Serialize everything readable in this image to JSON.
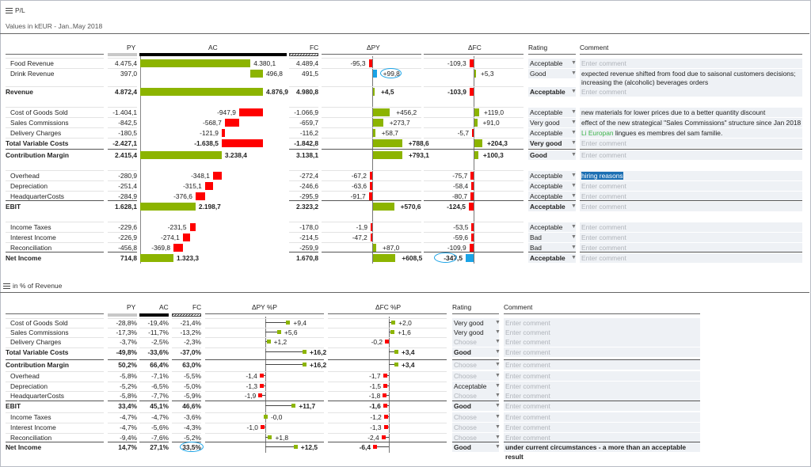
{
  "section1": {
    "title": "P/L",
    "subtitle": "Values in kEUR - Jan..May 2018",
    "headers": {
      "py": "PY",
      "ac": "AC",
      "fc": "FC",
      "dpy": "ΔPY",
      "dfc": "ΔFC",
      "rating": "Rating",
      "comment": "Comment"
    },
    "rows": [
      {
        "label": "Food Revenue",
        "indent": true,
        "bold": false,
        "py": "4.475,4",
        "ac": "4.380,1",
        "fc": "4.489,4",
        "dpy": "-95,3",
        "dfc": "-109,3",
        "ac_v": 4380.1,
        "dpy_v": -95.3,
        "dfc_v": -109.3,
        "rating": "Acceptable",
        "comment": "",
        "ac_type": "result"
      },
      {
        "label": "Drink Revenue",
        "indent": true,
        "bold": false,
        "py": "397,0",
        "ac": "496,8",
        "fc": "491,5",
        "dpy": "+99,8",
        "dfc": "+5,3",
        "ac_v": 496.8,
        "dpy_v": 99.8,
        "dfc_v": 5.3,
        "rating": "Good",
        "comment": "expected revenue shifted from food due to saisonal customers decisions; increasing the (alcoholic) beverages orders",
        "ac_type": "step",
        "dpy_highlight": true,
        "tall": true
      },
      {
        "label": "Revenue",
        "indent": false,
        "bold": true,
        "py": "4.872,4",
        "ac": "4.876,9",
        "fc": "4.980,8",
        "dpy": "+4,5",
        "dfc": "-103,9",
        "ac_v": 4876.9,
        "dpy_v": 4.5,
        "dfc_v": -103.9,
        "rating": "Acceptable",
        "comment": "",
        "ac_type": "result",
        "gap_after": true
      },
      {
        "label": "Cost of Goods Sold",
        "indent": true,
        "bold": false,
        "py": "-1.404,1",
        "ac": "-947,9",
        "fc": "-1.066,9",
        "dpy": "+456,2",
        "dfc": "+119,0",
        "ac_v": -947.9,
        "dpy_v": 456.2,
        "dfc_v": 119.0,
        "rating": "Acceptable",
        "comment": "new materials for lower prices due to a better quantity discount",
        "ac_type": "step"
      },
      {
        "label": "Sales Commissions",
        "indent": true,
        "bold": false,
        "py": "-842,5",
        "ac": "-568,7",
        "fc": "-659,7",
        "dpy": "+273,7",
        "dfc": "+91,0",
        "ac_v": -568.7,
        "dpy_v": 273.7,
        "dfc_v": 91.0,
        "rating": "Very good",
        "comment": "effect of the new strategical \"Sales Commissions\" structure since Jan 2018",
        "ac_type": "step"
      },
      {
        "label": "Delivery Charges",
        "indent": true,
        "bold": false,
        "py": "-180,5",
        "ac": "-121,9",
        "fc": "-116,2",
        "dpy": "+58,7",
        "dfc": "-5,7",
        "ac_v": -121.9,
        "dpy_v": 58.7,
        "dfc_v": -5.7,
        "rating": "Acceptable",
        "comment_green": "Li Europan",
        "comment": " lingues es membres del sam familie.",
        "ac_type": "step"
      },
      {
        "label": "Total Variable Costs",
        "indent": false,
        "bold": true,
        "py": "-2.427,1",
        "ac": "-1.638,5",
        "fc": "-1.842,8",
        "dpy": "+788,6",
        "dfc": "+204,3",
        "ac_v": -1638.5,
        "dpy_v": 788.6,
        "dfc_v": 204.3,
        "rating": "Very good",
        "comment": "",
        "ac_type": "sum"
      },
      {
        "label": "Contribution Margin",
        "indent": false,
        "bold": true,
        "py": "2.415,4",
        "ac": "3.238,4",
        "fc": "3.138,1",
        "dpy": "+793,1",
        "dfc": "+100,3",
        "ac_v": 3238.4,
        "dpy_v": 793.1,
        "dfc_v": 100.3,
        "rating": "Good",
        "comment": "",
        "ac_type": "result",
        "line_before": true,
        "gap_after": true
      },
      {
        "label": "Overhead",
        "indent": true,
        "bold": false,
        "py": "-280,9",
        "ac": "-348,1",
        "fc": "-272,4",
        "dpy": "-67,2",
        "dfc": "-75,7",
        "ac_v": -348.1,
        "dpy_v": -67.2,
        "dfc_v": -75.7,
        "rating": "Acceptable",
        "comment": "hiring reasons",
        "comment_selected": true,
        "ac_type": "step"
      },
      {
        "label": "Depreciation",
        "indent": true,
        "bold": false,
        "py": "-251,4",
        "ac": "-315,1",
        "fc": "-246,6",
        "dpy": "-63,6",
        "dfc": "-58,4",
        "ac_v": -315.1,
        "dpy_v": -63.6,
        "dfc_v": -58.4,
        "rating": "Acceptable",
        "comment": "",
        "ac_type": "step"
      },
      {
        "label": "HeadquarterCosts",
        "indent": true,
        "bold": false,
        "py": "-284,9",
        "ac": "-376,6",
        "fc": "-295,9",
        "dpy": "-91,7",
        "dfc": "-80,7",
        "ac_v": -376.6,
        "dpy_v": -91.7,
        "dfc_v": -80.7,
        "rating": "Acceptable",
        "comment": "",
        "ac_type": "step"
      },
      {
        "label": "EBIT",
        "indent": false,
        "bold": true,
        "py": "1.628,1",
        "ac": "2.198,7",
        "fc": "2.323,2",
        "dpy": "+570,6",
        "dfc": "-124,5",
        "ac_v": 2198.7,
        "dpy_v": 570.6,
        "dfc_v": -124.5,
        "rating": "Acceptable",
        "comment": "",
        "ac_type": "result",
        "line_before": true,
        "gap_after": true
      },
      {
        "label": "Income Taxes",
        "indent": true,
        "bold": false,
        "py": "-229,6",
        "ac": "-231,5",
        "fc": "-178,0",
        "dpy": "-1,9",
        "dfc": "-53,5",
        "ac_v": -231.5,
        "dpy_v": -1.9,
        "dfc_v": -53.5,
        "rating": "Acceptable",
        "comment": "",
        "ac_type": "step"
      },
      {
        "label": "Interest Income",
        "indent": true,
        "bold": false,
        "py": "-226,9",
        "ac": "-274,1",
        "fc": "-214,5",
        "dpy": "-47,2",
        "dfc": "-59,6",
        "ac_v": -274.1,
        "dpy_v": -47.2,
        "dfc_v": -59.6,
        "rating": "Bad",
        "comment": "",
        "ac_type": "step"
      },
      {
        "label": "Reconciliation",
        "indent": true,
        "bold": false,
        "py": "-456,8",
        "ac": "-369,8",
        "fc": "-259,9",
        "dpy": "+87,0",
        "dfc": "-109,9",
        "ac_v": -369.8,
        "dpy_v": 87.0,
        "dfc_v": -109.9,
        "rating": "Bad",
        "comment": "",
        "ac_type": "step"
      },
      {
        "label": "Net Income",
        "indent": false,
        "bold": true,
        "py": "714,8",
        "ac": "1.323,3",
        "fc": "1.670,8",
        "dpy": "+608,5",
        "dfc": "-347,5",
        "ac_v": 1323.3,
        "dpy_v": 608.5,
        "dfc_v": -347.5,
        "rating": "Acceptable",
        "comment": "",
        "ac_type": "result",
        "line_before": true,
        "dfc_highlight": true
      }
    ]
  },
  "section2": {
    "title": "in % of Revenue",
    "headers": {
      "py": "PY",
      "ac": "AC",
      "fc": "FC",
      "dpy": "ΔPY %P",
      "dfc": "ΔFC %P",
      "rating": "Rating",
      "comment": "Comment"
    },
    "rows": [
      {
        "label": "Cost of Goods Sold",
        "indent": true,
        "bold": false,
        "py": "-28,8%",
        "ac": "-19,4%",
        "fc": "-21,4%",
        "dpy": "+9,4",
        "dfc": "+2,0",
        "dpy_v": 9.4,
        "dfc_v": 2.0,
        "rating": "Very good",
        "comment": ""
      },
      {
        "label": "Sales Commissions",
        "indent": true,
        "bold": false,
        "py": "-17,3%",
        "ac": "-11,7%",
        "fc": "-13,2%",
        "dpy": "+5,6",
        "dfc": "+1,6",
        "dpy_v": 5.6,
        "dfc_v": 1.6,
        "rating": "Very good",
        "comment": ""
      },
      {
        "label": "Delivery Charges",
        "indent": true,
        "bold": false,
        "py": "-3,7%",
        "ac": "-2,5%",
        "fc": "-2,3%",
        "dpy": "+1,2",
        "dfc": "-0,2",
        "dpy_v": 1.2,
        "dfc_v": -0.2,
        "rating": "",
        "comment": ""
      },
      {
        "label": "Total Variable Costs",
        "indent": false,
        "bold": true,
        "py": "-49,8%",
        "ac": "-33,6%",
        "fc": "-37,0%",
        "dpy": "+16,2",
        "dfc": "+3,4",
        "dpy_v": 16.2,
        "dfc_v": 3.4,
        "rating": "Good",
        "comment": ""
      },
      {
        "label": "Contribution Margin",
        "indent": false,
        "bold": true,
        "py": "50,2%",
        "ac": "66,4%",
        "fc": "63,0%",
        "dpy": "+16,2",
        "dfc": "+3,4",
        "dpy_v": 16.2,
        "dfc_v": 3.4,
        "rating": "",
        "comment": "",
        "line_before": true
      },
      {
        "label": "Overhead",
        "indent": true,
        "bold": false,
        "py": "-5,8%",
        "ac": "-7,1%",
        "fc": "-5,5%",
        "dpy": "-1,4",
        "dfc": "-1,7",
        "dpy_v": -1.4,
        "dfc_v": -1.7,
        "rating": "",
        "comment": ""
      },
      {
        "label": "Depreciation",
        "indent": true,
        "bold": false,
        "py": "-5,2%",
        "ac": "-6,5%",
        "fc": "-5,0%",
        "dpy": "-1,3",
        "dfc": "-1,5",
        "dpy_v": -1.3,
        "dfc_v": -1.5,
        "rating": "Acceptable",
        "comment": ""
      },
      {
        "label": "HeadquarterCosts",
        "indent": true,
        "bold": false,
        "py": "-5,8%",
        "ac": "-7,7%",
        "fc": "-5,9%",
        "dpy": "-1,9",
        "dfc": "-1,8",
        "dpy_v": -1.9,
        "dfc_v": -1.8,
        "rating": "",
        "comment": ""
      },
      {
        "label": "EBIT",
        "indent": false,
        "bold": true,
        "py": "33,4%",
        "ac": "45,1%",
        "fc": "46,6%",
        "dpy": "+11,7",
        "dfc": "-1,6",
        "dpy_v": 11.7,
        "dfc_v": -1.6,
        "rating": "Good",
        "comment": "",
        "line_before": true
      },
      {
        "label": "Income Taxes",
        "indent": true,
        "bold": false,
        "py": "-4,7%",
        "ac": "-4,7%",
        "fc": "-3,6%",
        "dpy": "-0,0",
        "dfc": "-1,2",
        "dpy_v": -0.0,
        "dfc_v": -1.2,
        "rating": "",
        "comment": ""
      },
      {
        "label": "Interest Income",
        "indent": true,
        "bold": false,
        "py": "-4,7%",
        "ac": "-5,6%",
        "fc": "-4,3%",
        "dpy": "-1,0",
        "dfc": "-1,3",
        "dpy_v": -1.0,
        "dfc_v": -1.3,
        "rating": "",
        "comment": ""
      },
      {
        "label": "Reconciliation",
        "indent": true,
        "bold": false,
        "py": "-9,4%",
        "ac": "-7,6%",
        "fc": "-5,2%",
        "dpy": "+1,8",
        "dfc": "-2,4",
        "dpy_v": 1.8,
        "dfc_v": -2.4,
        "rating": "",
        "comment": ""
      },
      {
        "label": "Net Income",
        "indent": false,
        "bold": true,
        "py": "14,7%",
        "ac": "27,1%",
        "fc": "33,5%",
        "dpy": "+12,5",
        "dfc": "-6,4",
        "dpy_v": 12.5,
        "dfc_v": -6.4,
        "rating": "Good",
        "comment": "under current circumstances - a more than an acceptable result",
        "line_before": true,
        "fc_highlight": true
      }
    ]
  },
  "common": {
    "comment_placeholder": "Enter comment",
    "rating_placeholder": "Choose",
    "dropdown_icon": "▼"
  },
  "colors": {
    "positive": "#8cb400",
    "negative": "#ff0000",
    "highlight": "#1aa3e6",
    "input_bg": "#eef1f5"
  }
}
